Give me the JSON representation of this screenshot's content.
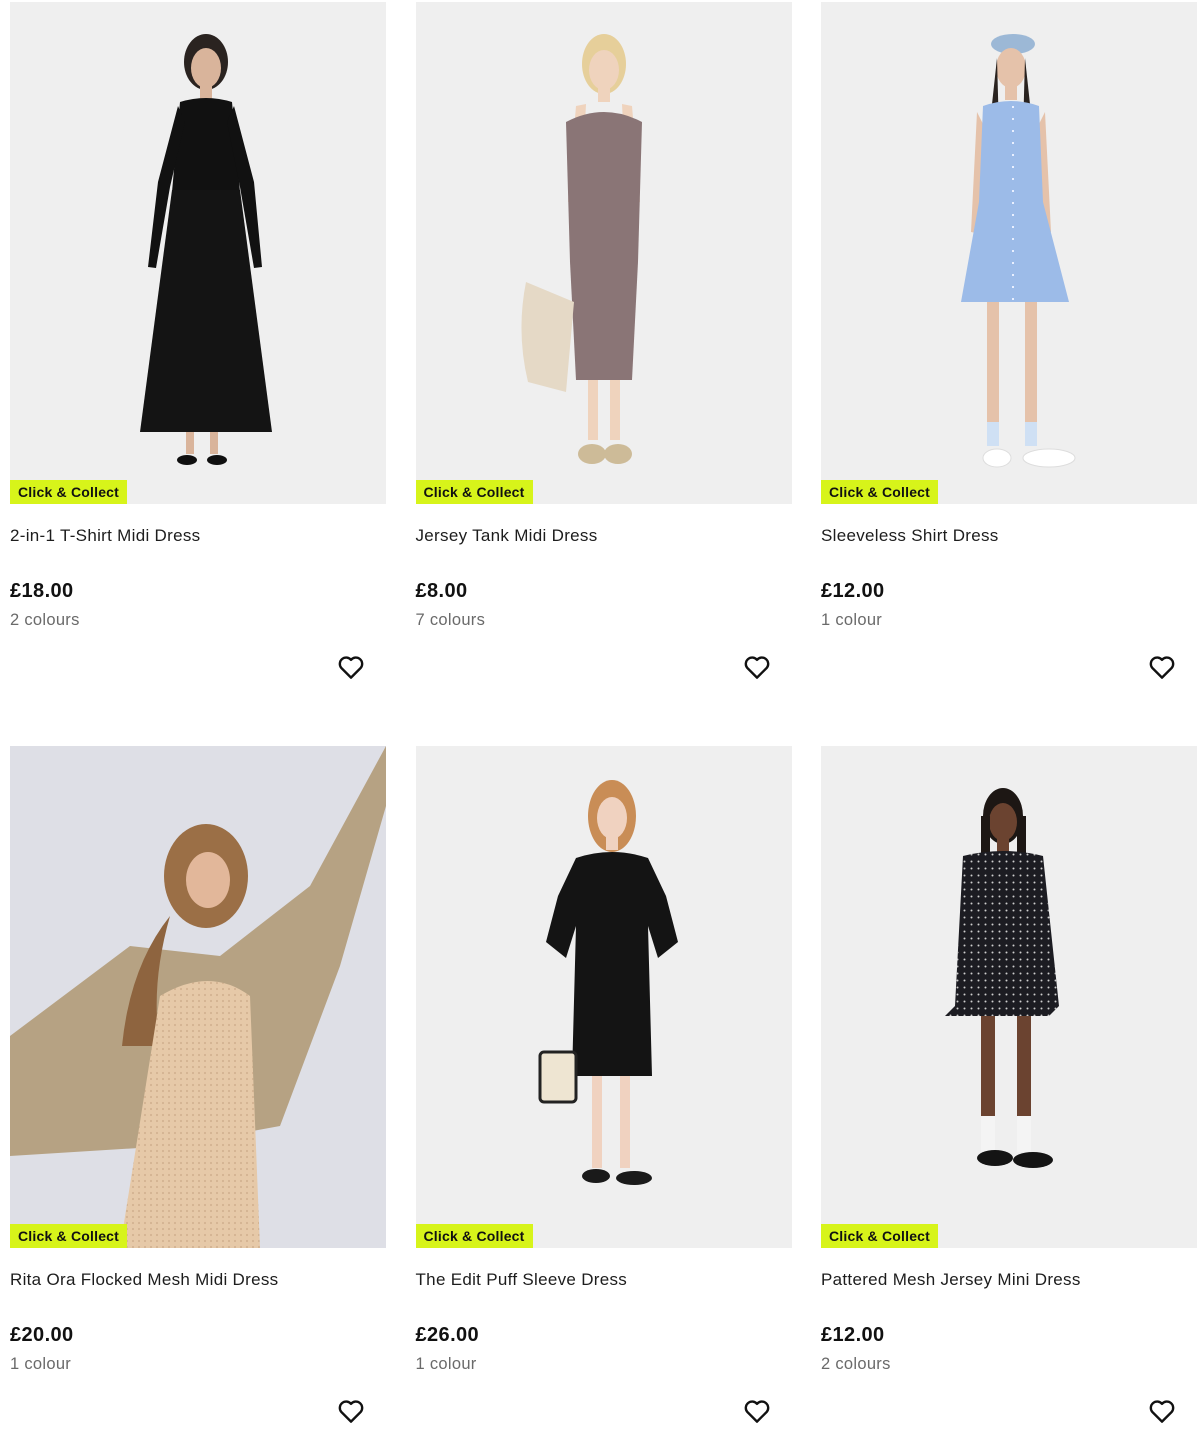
{
  "badge_color": "#d7f41a",
  "products": [
    {
      "name": "2-in-1 T-Shirt Midi Dress",
      "price": "£18.00",
      "colours": "2 colours",
      "badge": "Click & Collect",
      "icon": "heart-outline-icon"
    },
    {
      "name": "Jersey Tank Midi Dress",
      "price": "£8.00",
      "colours": "7 colours",
      "badge": "Click & Collect",
      "icon": "heart-outline-icon"
    },
    {
      "name": "Sleeveless Shirt Dress",
      "price": "£12.00",
      "colours": "1 colour",
      "badge": "Click & Collect",
      "icon": "heart-outline-icon"
    },
    {
      "name": "Rita Ora Flocked Mesh Midi Dress",
      "price": "£20.00",
      "colours": "1 colour",
      "badge": "Click & Collect",
      "icon": "heart-outline-icon"
    },
    {
      "name": "The Edit Puff Sleeve Dress",
      "price": "£26.00",
      "colours": "1 colour",
      "badge": "Click & Collect",
      "icon": "heart-outline-icon"
    },
    {
      "name": "Pattered Mesh Jersey Mini Dress",
      "price": "£12.00",
      "colours": "2 colours",
      "badge": "Click & Collect",
      "icon": "heart-outline-icon"
    }
  ]
}
